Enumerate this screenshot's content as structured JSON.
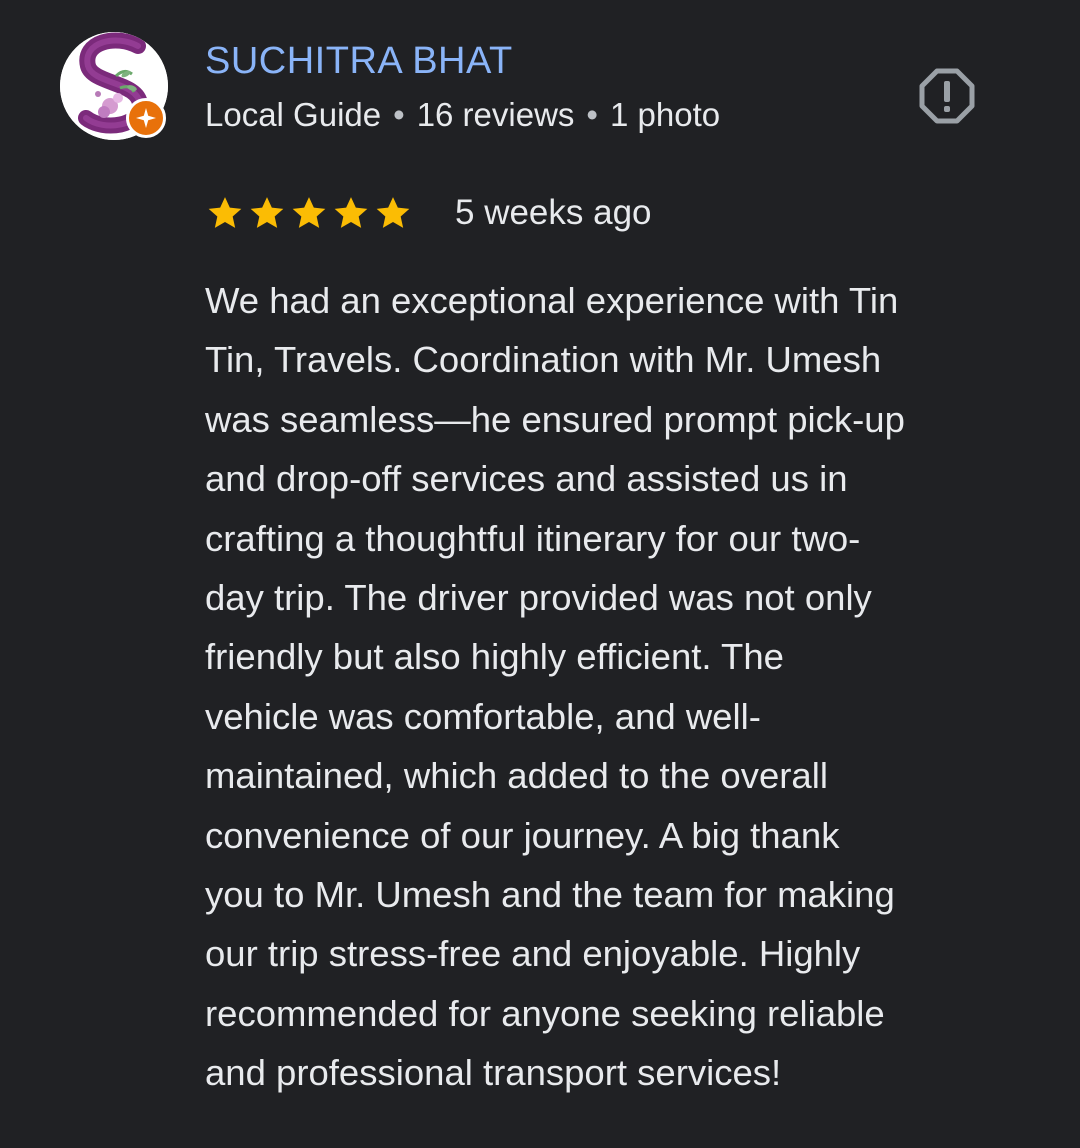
{
  "reviewer": {
    "name": "SUCHITRA BHAT",
    "badge": "Local Guide",
    "reviews": "16 reviews",
    "photos": "1 photo",
    "separator": "•",
    "avatar_icon": "monogram-s-floral-avatar",
    "badge_icon": "local-guide-star-icon"
  },
  "review": {
    "rating": 5,
    "rating_max": 5,
    "date": "5 weeks ago",
    "text": "We had an exceptional experience with Tin\nTin, Travels. Coordination with Mr. Umesh\nwas seamless—he ensured prompt pick-up\nand drop-off services and assisted us in\ncrafting a thoughtful itinerary for our two-\nday trip. The driver provided was not only\nfriendly but also highly efficient. The\nvehicle was comfortable, and well-\nmaintained, which added to the overall\nconvenience of our journey. A big thank\nyou to Mr. Umesh and the team for making\nour trip stress-free and enjoyable. Highly\nrecommended for anyone seeking reliable\nand professional transport services!"
  },
  "actions": {
    "report_icon": "report-octagon-icon"
  },
  "colors": {
    "background": "#202124",
    "name": "#8ab4f8",
    "text": "#e8eaed",
    "star": "#fbbc04",
    "badge": "#e8710a",
    "report_icon": "#9aa0a6",
    "avatar_monogram": "#7b2a7b"
  }
}
